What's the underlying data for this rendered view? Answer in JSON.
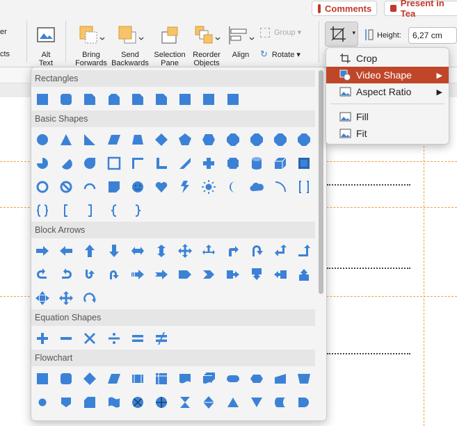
{
  "topbar": {
    "comments": "Comments",
    "present": "Present in Tea"
  },
  "ribbon": {
    "left_cut_1": "er",
    "left_cut_2": "cts",
    "alt_text": "Alt\nText",
    "bring_forward": "Bring\nForwards",
    "send_backward": "Send\nBackwards",
    "selection_pane": "Selection\nPane",
    "reorder_objects": "Reorder\nObjects",
    "align": "Align",
    "group": "Group",
    "rotate": "Rotate",
    "height_label": "Height:",
    "height_value": "6,27 cm"
  },
  "crop_menu": {
    "items": [
      {
        "label": "Crop",
        "icon": "crop-icon"
      },
      {
        "label": "Video Shape",
        "icon": "video-shape-icon",
        "submenu": true,
        "selected": true
      },
      {
        "label": "Aspect Ratio",
        "icon": "image-icon",
        "submenu": true
      },
      {
        "label": "Fill",
        "icon": "image-icon"
      },
      {
        "label": "Fit",
        "icon": "image-icon"
      }
    ]
  },
  "gallery": {
    "sections": [
      {
        "title": "Rectangles"
      },
      {
        "title": "Basic Shapes"
      },
      {
        "title": "Block Arrows"
      },
      {
        "title": "Equation Shapes"
      },
      {
        "title": "Flowchart"
      }
    ]
  },
  "colors": {
    "shape_fill": "#3b82d6",
    "accent": "#c0462a"
  }
}
